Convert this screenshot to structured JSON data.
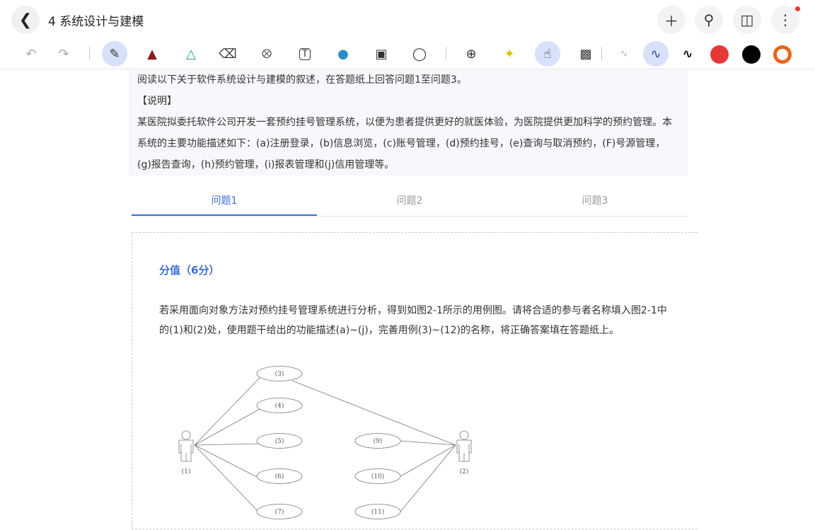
{
  "header": {
    "title": "4 系统设计与建模",
    "back_icon": "chevron-left-icon",
    "actions": [
      "plus-icon",
      "search-icon",
      "sidebar-panel-icon",
      "more-icon"
    ]
  },
  "toolbar": {
    "tools": [
      "undo-icon",
      "redo-icon",
      "pen-icon",
      "marker-icon",
      "highlighter-icon",
      "eraser-icon",
      "lasso-icon",
      "text-box-icon",
      "shape-icon",
      "image-icon",
      "sticker-icon",
      "zoom-in-icon",
      "laser-pointer-icon",
      "hand-touch-icon",
      "pattern-icon"
    ],
    "colors": [
      "#e53935",
      "#000000",
      "#e8661a"
    ]
  },
  "description": {
    "intro": "阅读以下关于软件系统设计与建模的叙述，在答题纸上回答问题1至问题3。",
    "heading": "【说明】",
    "body": "某医院拟委托软件公司开发一套预约挂号管理系统，以便为患者提供更好的就医体验，为医院提供更加科学的预约管理。本系统的主要功能描述如下：(a)注册登录，(b)信息浏览，(c)账号管理，(d)预约挂号，(e)查询与取消预约，(F)号源管理，(g)报告查询，(h)预约管理，(i)报表管理和(j)信用管理等。"
  },
  "tabs": [
    {
      "label": "问题1"
    },
    {
      "label": "问题2"
    },
    {
      "label": "问题3"
    }
  ],
  "question": {
    "score": "分值（6分）",
    "text": "若采用面向对象方法对预约挂号管理系统进行分析，得到如图2-1所示的用例图。请将合适的参与者名称填入图2-1中的(1)和(2)处，使用题干给出的功能描述(a)~(j)，完善用例(3)~(12)的名称，将正确答案填在答题纸上。"
  },
  "diagram": {
    "actors": [
      "(1)",
      "(2)"
    ],
    "left_cases": [
      "(3)",
      "(4)",
      "(5)",
      "(6)",
      "(7)"
    ],
    "right_cases": [
      "(9)",
      "(10)",
      "(11)"
    ]
  }
}
